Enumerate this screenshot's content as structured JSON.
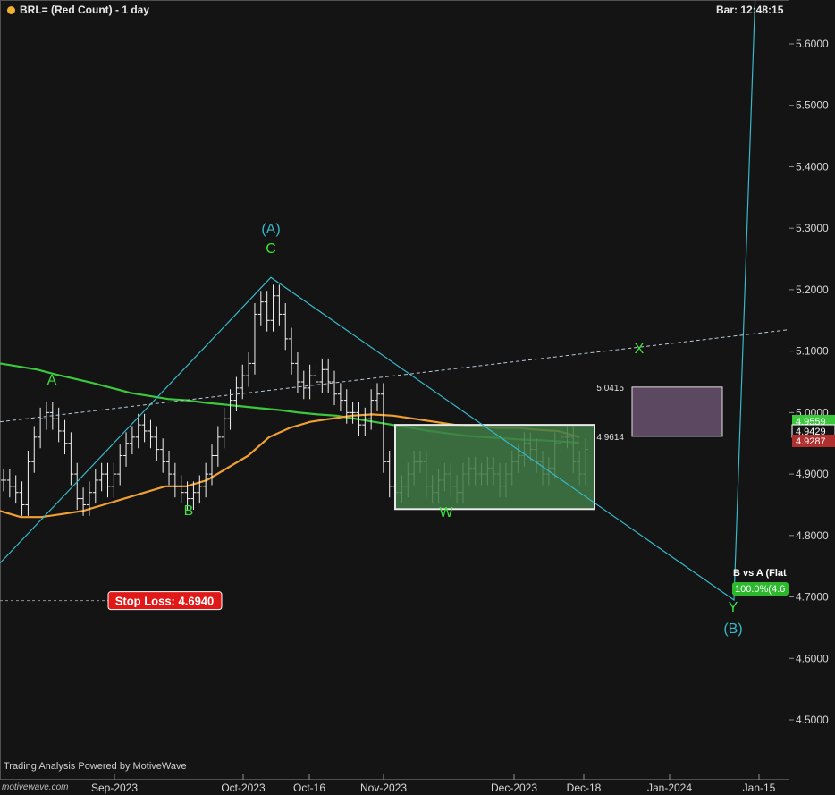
{
  "header": {
    "title": "BRL= (Red Count) - 1 day",
    "bar_time": "Bar: 12:48:15"
  },
  "footer": {
    "text": "Trading Analysis Powered by MotiveWave",
    "watermark": "motivewave.com"
  },
  "colors": {
    "background": "#141414",
    "bars": "#f2f2f2",
    "ma_green": "#3cc83c",
    "ma_orange": "#f0a030",
    "wave_line": "#38b8c8",
    "label_green": "#3ce03c",
    "label_cyan": "#38b8c8",
    "box_green_fill": "#3f7a45",
    "box_purple_fill": "#5c4860",
    "stop_loss": "#e01818"
  },
  "chart_data": {
    "type": "ohlc-bar",
    "symbol": "BRL=",
    "timeframe": "1 day",
    "y_axis": {
      "ticks": [
        4.5,
        4.6,
        4.7,
        4.8,
        4.9,
        5.0,
        5.1,
        5.2,
        5.3,
        5.4,
        5.5,
        5.6
      ],
      "tick_labels": [
        "4.5000",
        "4.6000",
        "4.7000",
        "4.8000",
        "4.9000",
        "5.0000",
        "5.1000",
        "5.2000",
        "5.3000",
        "5.4000",
        "5.5000",
        "5.6000"
      ],
      "ylim": [
        4.42,
        5.67
      ]
    },
    "x_axis": {
      "tick_labels": [
        "Sep-2023",
        "Oct-2023",
        "Oct-16",
        "Nov-2023",
        "Dec-2023",
        "Dec-18",
        "Jan-2024",
        "Jan-15"
      ]
    },
    "price_markers": [
      {
        "label": "4.9559",
        "value": 4.9559,
        "color": "#3cc83c"
      },
      {
        "label": "4.9429",
        "value": 4.9429,
        "color": "#ffffff"
      },
      {
        "label": "4.9287",
        "value": 4.9287,
        "color": "#b03030"
      }
    ],
    "closes": [
      4.89,
      4.88,
      4.87,
      4.85,
      4.92,
      4.96,
      4.99,
      5.0,
      4.99,
      4.97,
      4.95,
      4.9,
      4.86,
      4.85,
      4.87,
      4.89,
      4.9,
      4.88,
      4.9,
      4.93,
      4.95,
      4.96,
      4.98,
      4.97,
      4.96,
      4.94,
      4.92,
      4.9,
      4.88,
      4.87,
      4.86,
      4.87,
      4.88,
      4.9,
      4.93,
      4.96,
      4.99,
      5.02,
      5.04,
      5.06,
      5.08,
      5.16,
      5.18,
      5.15,
      5.19,
      5.16,
      5.12,
      5.08,
      5.05,
      5.04,
      5.06,
      5.05,
      5.07,
      5.05,
      5.03,
      5.02,
      5.0,
      5.0,
      4.98,
      4.99,
      5.02,
      5.03,
      4.92,
      4.88,
      4.87,
      4.88,
      4.9,
      4.92,
      4.92,
      4.88,
      4.87,
      4.89,
      4.9,
      4.88,
      4.87,
      4.9,
      4.91,
      4.9,
      4.9,
      4.91,
      4.9,
      4.88,
      4.9,
      4.92,
      4.93,
      4.95,
      4.94,
      4.92,
      4.9,
      4.91,
      4.95,
      4.96,
      4.96,
      4.92,
      4.9,
      4.94
    ],
    "moving_averages": [
      {
        "color": "#3cc83c",
        "values": [
          5.08,
          5.075,
          5.07,
          5.062,
          5.055,
          5.048,
          5.04,
          5.032,
          5.027,
          5.022,
          5.02,
          5.016,
          5.013,
          5.01,
          5.007,
          5.004,
          5.0,
          4.997,
          4.995,
          4.99,
          4.985,
          4.98,
          4.975,
          4.97,
          4.966,
          4.962,
          4.96,
          4.958,
          4.956,
          4.955,
          4.953,
          4.951
        ]
      },
      {
        "color": "#f0a030",
        "values": [
          4.84,
          4.83,
          4.83,
          4.835,
          4.84,
          4.85,
          4.86,
          4.87,
          4.88,
          4.88,
          4.89,
          4.91,
          4.93,
          4.96,
          4.975,
          4.985,
          4.99,
          4.995,
          4.997,
          4.995,
          4.99,
          4.985,
          4.98,
          4.978,
          4.975,
          4.975,
          4.972,
          4.97,
          4.96
        ]
      }
    ],
    "annotations": {
      "wave_labels": [
        {
          "text": "A",
          "color": "#3ce03c"
        },
        {
          "text": "B",
          "color": "#3ce03c"
        },
        {
          "text": "C",
          "color": "#3ce03c"
        },
        {
          "text": "(A)",
          "color": "#38b8c8"
        },
        {
          "text": "W",
          "color": "#3ce03c"
        },
        {
          "text": "X",
          "color": "#3ce03c"
        },
        {
          "text": "Y",
          "color": "#3ce03c"
        },
        {
          "text": "(B)",
          "color": "#38b8c8"
        }
      ],
      "wave_path": [
        4.755,
        5.22,
        4.695,
        5.73
      ],
      "trendline_dashed": [
        4.985,
        5.135
      ],
      "box_w": {
        "top": 4.98,
        "bottom": 4.843
      },
      "box_x": {
        "top": 5.0415,
        "bottom": 4.9614,
        "top_label": "5.0415",
        "bottom_label": "4.9614"
      },
      "stop_loss": {
        "value": 4.694,
        "label": "Stop Loss: 4.6940"
      },
      "target_note": "B vs A (Flat",
      "target_badge": "100.0%(4.6"
    }
  }
}
